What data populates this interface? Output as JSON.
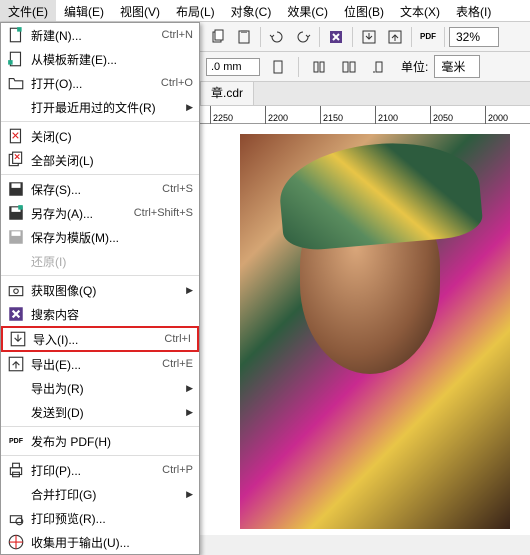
{
  "menubar": {
    "items": [
      {
        "label": "文件(E)"
      },
      {
        "label": "编辑(E)"
      },
      {
        "label": "视图(V)"
      },
      {
        "label": "布局(L)"
      },
      {
        "label": "对象(C)"
      },
      {
        "label": "效果(C)"
      },
      {
        "label": "位图(B)"
      },
      {
        "label": "文本(X)"
      },
      {
        "label": "表格(I)"
      }
    ]
  },
  "toolbar": {
    "zoom": "32%",
    "dim": ".0 mm",
    "units_label": "单位:",
    "units_value": "毫米"
  },
  "tab": {
    "label": "章.cdr"
  },
  "ruler": {
    "ticks": [
      "2250",
      "2200",
      "2150",
      "2100",
      "2050",
      "2000"
    ]
  },
  "menu": {
    "items": [
      {
        "icon": "new",
        "label": "新建(N)...",
        "shortcut": "Ctrl+N"
      },
      {
        "icon": "template",
        "label": "从模板新建(E)...",
        "shortcut": ""
      },
      {
        "icon": "open",
        "label": "打开(O)...",
        "shortcut": "Ctrl+O"
      },
      {
        "icon": "",
        "label": "打开最近用过的文件(R)",
        "shortcut": "",
        "submenu": true
      },
      {
        "sep": true
      },
      {
        "icon": "close",
        "label": "关闭(C)",
        "shortcut": ""
      },
      {
        "icon": "closeall",
        "label": "全部关闭(L)",
        "shortcut": ""
      },
      {
        "sep": true
      },
      {
        "icon": "save",
        "label": "保存(S)...",
        "shortcut": "Ctrl+S"
      },
      {
        "icon": "saveas",
        "label": "另存为(A)...",
        "shortcut": "Ctrl+Shift+S"
      },
      {
        "icon": "savetmpl",
        "label": "保存为模版(M)...",
        "shortcut": ""
      },
      {
        "icon": "",
        "label": "还原(I)",
        "shortcut": "",
        "disabled": true
      },
      {
        "sep": true
      },
      {
        "icon": "acquire",
        "label": "获取图像(Q)",
        "shortcut": "",
        "submenu": true
      },
      {
        "icon": "search",
        "label": "搜索内容",
        "shortcut": ""
      },
      {
        "icon": "import",
        "label": "导入(I)...",
        "shortcut": "Ctrl+I",
        "highlighted": true
      },
      {
        "icon": "export",
        "label": "导出(E)...",
        "shortcut": "Ctrl+E"
      },
      {
        "icon": "",
        "label": "导出为(R)",
        "shortcut": "",
        "submenu": true
      },
      {
        "icon": "",
        "label": "发送到(D)",
        "shortcut": "",
        "submenu": true
      },
      {
        "sep": true
      },
      {
        "icon": "pdf",
        "label": "发布为 PDF(H)",
        "shortcut": ""
      },
      {
        "sep": true
      },
      {
        "icon": "print",
        "label": "打印(P)...",
        "shortcut": "Ctrl+P"
      },
      {
        "icon": "",
        "label": "合并打印(G)",
        "shortcut": "",
        "submenu": true
      },
      {
        "icon": "preview",
        "label": "打印预览(R)...",
        "shortcut": ""
      },
      {
        "icon": "collect",
        "label": "收集用于输出(U)...",
        "shortcut": ""
      }
    ]
  }
}
